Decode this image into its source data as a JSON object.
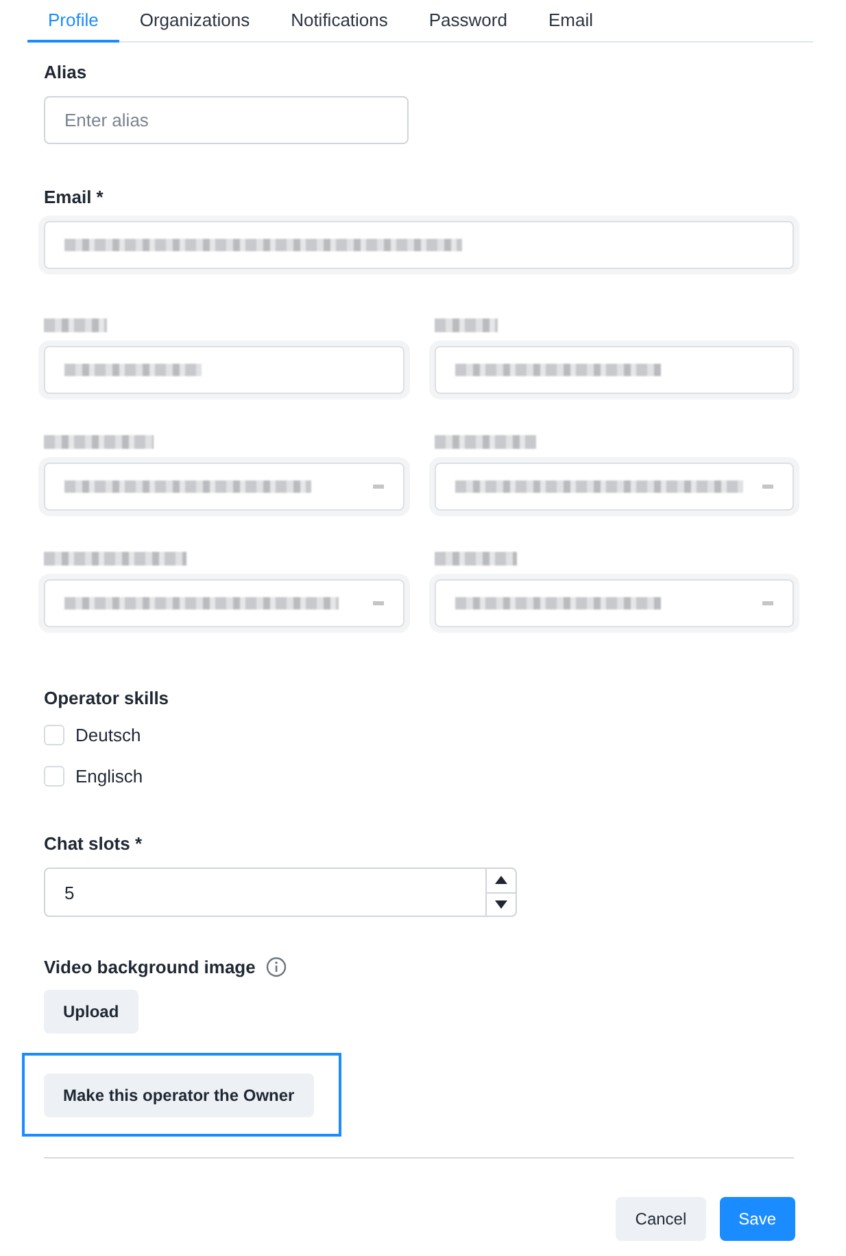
{
  "tabs": [
    {
      "label": "Profile",
      "selected": true
    },
    {
      "label": "Organizations",
      "selected": false
    },
    {
      "label": "Notifications",
      "selected": false
    },
    {
      "label": "Password",
      "selected": false
    },
    {
      "label": "Email",
      "selected": false
    }
  ],
  "alias": {
    "label": "Alias",
    "placeholder": "Enter alias"
  },
  "email": {
    "label": "Email *"
  },
  "blurred_fields": [
    {
      "kind": "text"
    },
    {
      "kind": "text"
    },
    {
      "kind": "select"
    },
    {
      "kind": "select"
    },
    {
      "kind": "select"
    },
    {
      "kind": "select"
    }
  ],
  "skills": {
    "label": "Operator skills",
    "items": [
      {
        "label": "Deutsch",
        "checked": false
      },
      {
        "label": "Englisch",
        "checked": false
      }
    ]
  },
  "chat_slots": {
    "label": "Chat slots *",
    "value": "5"
  },
  "video_background": {
    "label": "Video background image",
    "button": "Upload"
  },
  "owner_button": {
    "label": "Make this operator the Owner",
    "highlighted": true
  },
  "footer": {
    "cancel": "Cancel",
    "save": "Save"
  }
}
